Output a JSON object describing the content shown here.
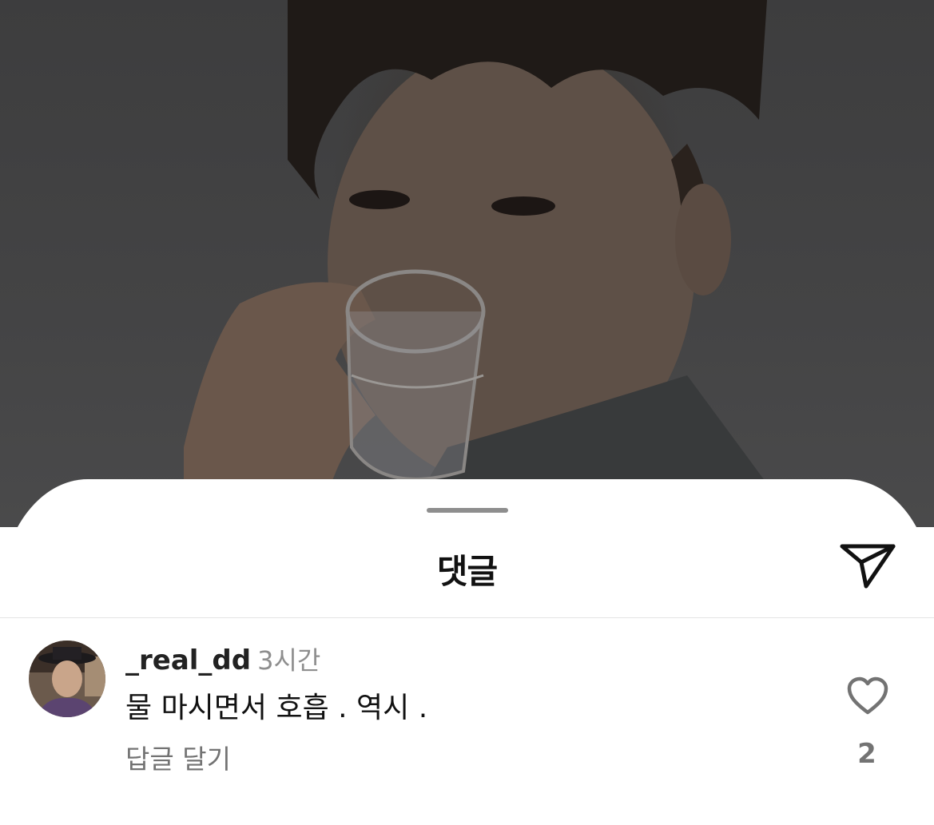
{
  "sheet": {
    "title": "댓글",
    "share_icon": "paper-plane-icon"
  },
  "comment": {
    "username": "_real_dd",
    "time": "3시간",
    "text": "물 마시면서 호흡 . 역시 .",
    "reply_label": "답글 달기",
    "like_icon": "heart-outline-icon",
    "like_count": "2"
  },
  "colors": {
    "overlay": "#3d3d3e",
    "sheet_bg": "#ffffff",
    "text_primary": "#111111",
    "text_secondary": "#737373",
    "divider": "#e3e3e3"
  }
}
